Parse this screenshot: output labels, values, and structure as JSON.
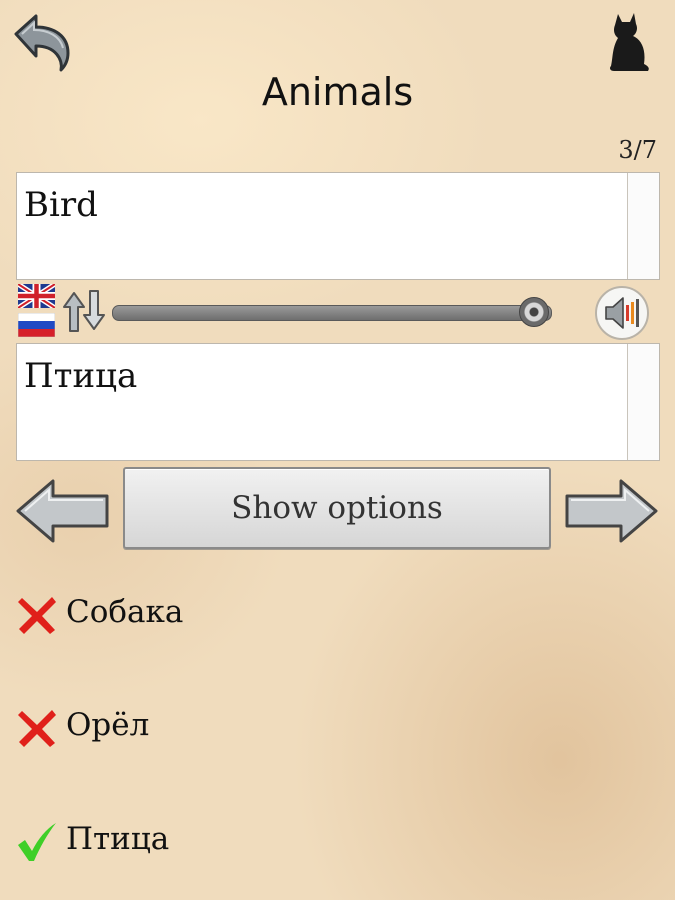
{
  "header": {
    "back_icon": "back-arrow-icon",
    "cat_icon": "cat-silhouette-icon",
    "title": "Animals",
    "counter": "3/7"
  },
  "source": {
    "text": "Bird",
    "language_flag": "uk-flag-icon"
  },
  "target": {
    "text": "Птица",
    "language_flag": "ru-flag-icon"
  },
  "controls": {
    "swap_icon": "swap-arrows-icon",
    "speed_level": 0.96,
    "speaker_icon": "speaker-icon"
  },
  "navigation": {
    "prev_icon": "arrow-left-icon",
    "next_icon": "arrow-right-icon",
    "show_options_label": "Show options"
  },
  "options": [
    {
      "label": "Собака",
      "status": "wrong",
      "icon": "cross-icon",
      "color": "#e0201a"
    },
    {
      "label": "Орёл",
      "status": "wrong",
      "icon": "cross-icon",
      "color": "#e0201a"
    },
    {
      "label": "Птица",
      "status": "correct",
      "icon": "check-icon",
      "color": "#3fcf28"
    }
  ]
}
